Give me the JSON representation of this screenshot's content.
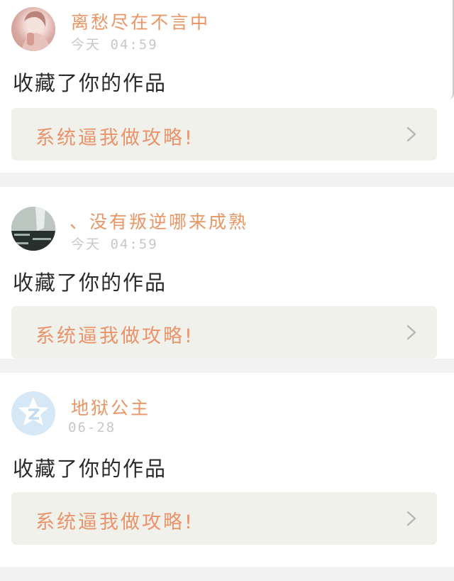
{
  "notifications": [
    {
      "avatar_icon": "user-photo-avatar",
      "username": "离愁尽在不言中",
      "time": "今天 04:59",
      "action": "收藏了你的作品",
      "work_title": "系统逼我做攻略!",
      "chevron_icon": "chevron-right-icon"
    },
    {
      "avatar_icon": "user-photo-avatar",
      "username": "、没有叛逆哪来成熟",
      "time": "今天 04:59",
      "action": "收藏了你的作品",
      "work_title": "系统逼我做攻略!",
      "chevron_icon": "chevron-right-icon"
    },
    {
      "avatar_icon": "qq-default-avatar",
      "username": "地狱公主",
      "time": "06-28",
      "action": "收藏了你的作品",
      "work_title": "系统逼我做攻略!",
      "chevron_icon": "chevron-right-icon"
    }
  ],
  "colors": {
    "username": "#e99564",
    "work_title": "#eb936a",
    "time": "#c7c7c7",
    "action": "#2a2a2a",
    "work_bg": "#f1f1ec",
    "page_bg": "#f2f2f2"
  }
}
